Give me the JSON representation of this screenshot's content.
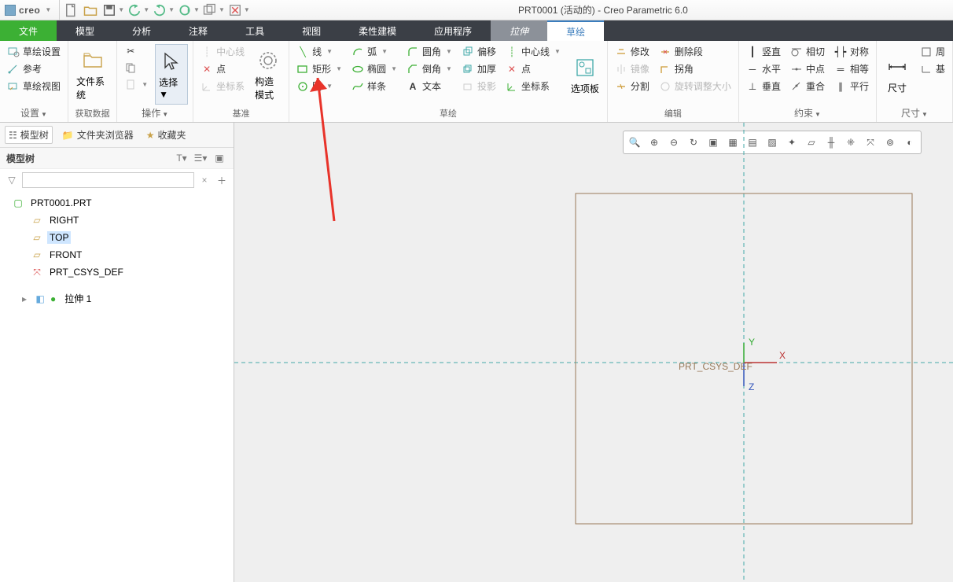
{
  "app": {
    "logo": "creo",
    "title": "PRT0001 (活动的) - Creo Parametric 6.0"
  },
  "menu": {
    "file": "文件",
    "model": "模型",
    "analysis": "分析",
    "annotate": "注释",
    "tools": "工具",
    "view": "视图",
    "flex": "柔性建模",
    "apps": "应用程序",
    "extrude": "拉伸",
    "sketch": "草绘"
  },
  "ribbon": {
    "setup": {
      "label": "设置",
      "sketch_setup": "草绘设置",
      "reference": "参考",
      "sketch_view": "草绘视图"
    },
    "getdata": {
      "label": "获取数据",
      "filesystem": "文件系统"
    },
    "ops": {
      "label": "操作",
      "select": "选择"
    },
    "datum": {
      "label": "基准",
      "centerline": "中心线",
      "point": "点",
      "csys": "坐标系",
      "construct": "构造模式"
    },
    "sketch": {
      "label": "草绘",
      "line": "线",
      "rect": "矩形",
      "circle": "圆",
      "arc": "弧",
      "ellipse": "椭圆",
      "spline": "样条",
      "fillet": "圆角",
      "chamfer": "倒角",
      "text": "文本",
      "offset": "偏移",
      "thicken": "加厚",
      "project": "投影",
      "centerline2": "中心线",
      "point2": "点",
      "csys2": "坐标系",
      "palette": "选项板"
    },
    "edit": {
      "label": "编辑",
      "modify": "修改",
      "delete_seg": "删除段",
      "mirror": "镜像",
      "corner": "拐角",
      "divide": "分割",
      "rotate_resize": "旋转调整大小"
    },
    "constrain": {
      "label": "约束",
      "vertical": "竖直",
      "tangent": "相切",
      "symmetric": "对称",
      "horizontal": "水平",
      "midpoint": "中点",
      "equal": "相等",
      "perpendicular": "垂直",
      "coincident": "重合",
      "parallel": "平行"
    },
    "dim_group": {
      "label": "尺寸",
      "dim": "尺寸",
      "perimeter": "周",
      "baseline": "基"
    }
  },
  "sidepanel": {
    "tabs": {
      "model_tree": "模型树",
      "folder_browser": "文件夹浏览器",
      "favorites": "收藏夹"
    },
    "header": "模型树",
    "tree": {
      "root": "PRT0001.PRT",
      "right": "RIGHT",
      "top": "TOP",
      "front": "FRONT",
      "csys": "PRT_CSYS_DEF",
      "extrude1": "拉伸 1"
    }
  },
  "canvas": {
    "csys_label": "PRT_CSYS_DEF",
    "y": "Y",
    "x": "X",
    "z": "Z"
  }
}
